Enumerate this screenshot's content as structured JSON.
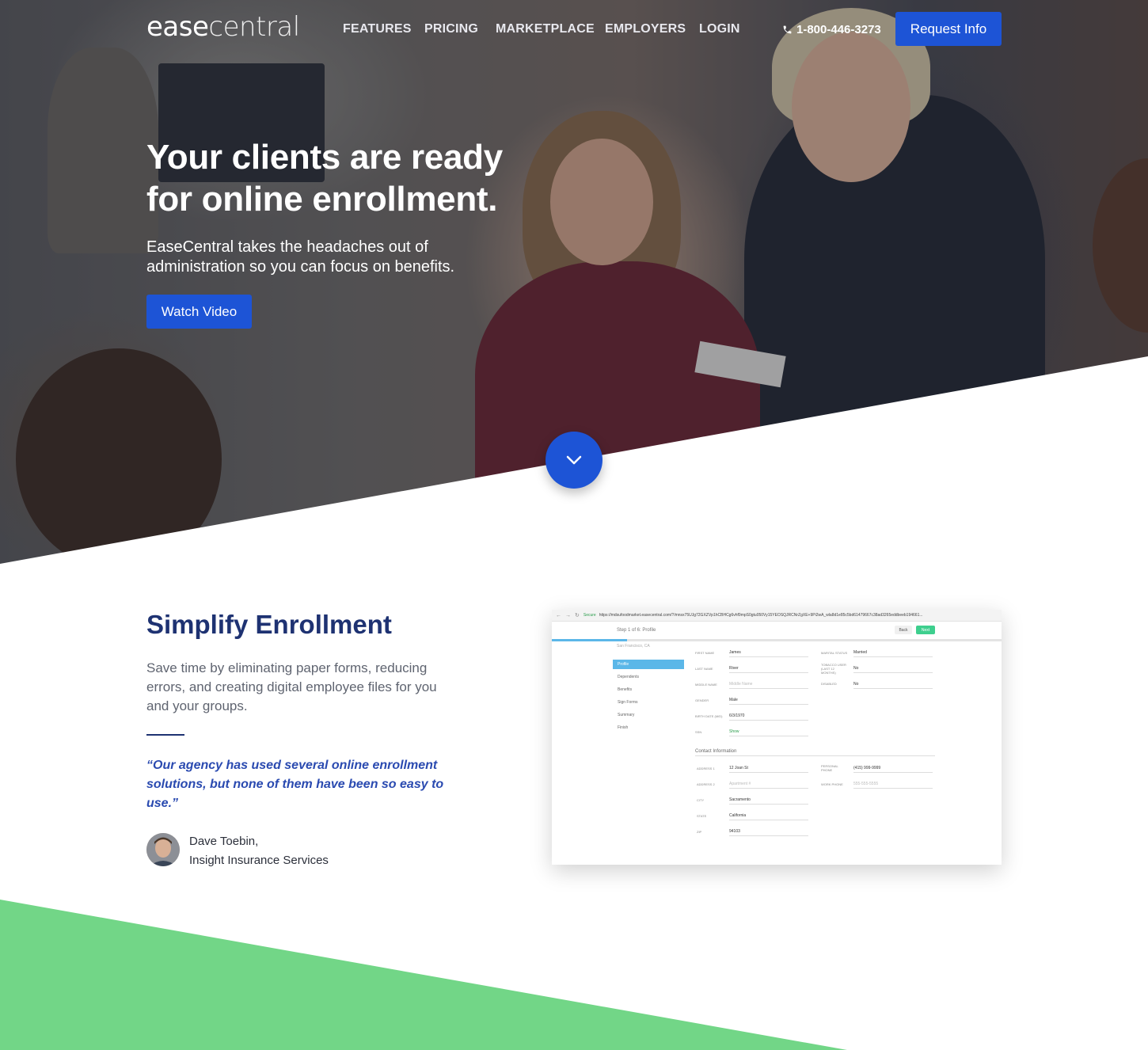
{
  "nav": {
    "logo_part1": "ease",
    "logo_part2": "central",
    "links": [
      "FEATURES",
      "PRICING",
      "MARKETPLACE",
      "EMPLOYERS",
      "LOGIN"
    ],
    "phone": "1-800-446-3273",
    "cta": "Request Info"
  },
  "hero": {
    "title_line1": "Your clients are ready",
    "title_line2": "for online enrollment.",
    "subtitle_line1": "EaseCentral takes the headaches out of",
    "subtitle_line2": "administration so you can focus on benefits.",
    "button": "Watch Video"
  },
  "section": {
    "title": "Simplify Enrollment",
    "body": "Save time by eliminating paper forms, reducing errors, and creating digital employee files for you and your groups.",
    "quote": "“Our agency has used several online enrollment solutions, but none of them have been so easy to use.”",
    "author_name": "Dave Toebin,",
    "author_company": "Insight Insurance Services"
  },
  "screenshot": {
    "secure": "Secure",
    "url": "https://mdsufoodmarket.easecentral.com/?/mnsx75UJg72GXZVp1hCBHCg6vhf9mpS0gtu050Vy15YEOSQJRCNrZgXE+9Pi2wA_wla8d1e85c5bd61479667c38ad3265eddbeeb194661...",
    "step": "Step 1 of 6: Profile",
    "back": "Back",
    "next": "Next",
    "city": "San Francisco, CA",
    "sidebar": [
      "Profile",
      "Dependents",
      "Benefits",
      "Sign Forms",
      "Summary",
      "Finish"
    ],
    "fields": {
      "first_name_label": "FIRST NAME",
      "first_name": "James",
      "last_name_label": "LAST NAME",
      "last_name": "River",
      "middle_name_label": "MIDDLE NAME",
      "middle_name_placeholder": "Middle Name",
      "gender_label": "GENDER",
      "gender": "Male",
      "birth_label": "BIRTH DATE (M/D)",
      "birth": "6/3/1970",
      "ssn_label": "SSN",
      "ssn": "Show",
      "marital_label": "MARITAL STATUS",
      "marital": "Married",
      "tobacco_label": "TOBACCO USER (LAST 12 MONTHS)",
      "tobacco": "No",
      "disabled_label": "DISABLED",
      "disabled": "No"
    },
    "contact_title": "Contact Information",
    "contact": {
      "address1_label": "ADDRESS 1",
      "address1": "12 Joan St",
      "address2_label": "ADDRESS 2",
      "address2_placeholder": "Apartment #",
      "city_label": "CITY",
      "city": "Sacramento",
      "state_label": "STATE",
      "state": "California",
      "zip_label": "ZIP",
      "zip": "94103",
      "personal_label": "PERSONAL PHONE",
      "personal": "(415) 999-9999",
      "work_label": "WORK PHONE",
      "work_placeholder": "555-555-5555"
    }
  },
  "colors": {
    "primary": "#1d54d6",
    "heading": "#1e3272",
    "quote": "#2a4ab0",
    "green": "#72d687"
  }
}
